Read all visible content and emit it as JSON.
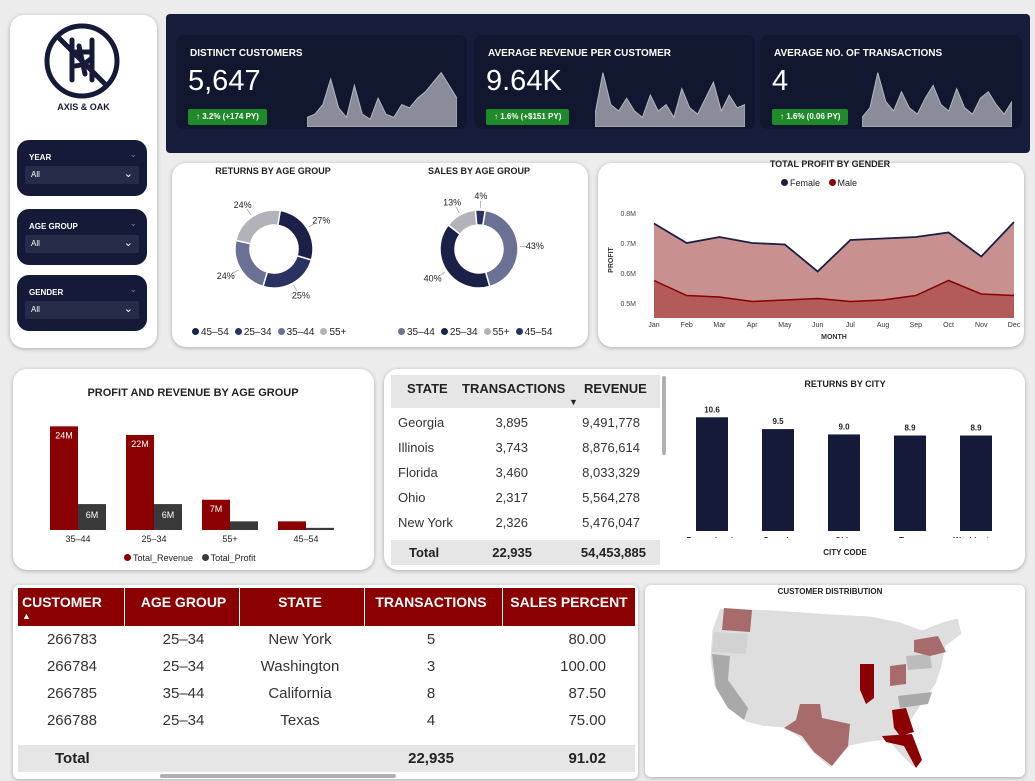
{
  "brand": {
    "name": "AXIS & OAK"
  },
  "filters": [
    {
      "label": "YEAR",
      "value": "All"
    },
    {
      "label": "AGE GROUP",
      "value": "All"
    },
    {
      "label": "GENDER",
      "value": "All"
    }
  ],
  "kpis": [
    {
      "title": "DISTINCT CUSTOMERS",
      "value": "5,647",
      "badge": "↑ 3.2% (+174 PY)"
    },
    {
      "title": "AVERAGE REVENUE PER CUSTOMER",
      "value": "9.64K",
      "badge": "↑ 1.6% (+$151 PY)"
    },
    {
      "title": "AVERAGE NO. OF TRANSACTIONS",
      "value": "4",
      "badge": "↑ 1.6% (0.06 PY)"
    }
  ],
  "returns_age": {
    "title": "RETURNS BY AGE GROUP",
    "labels": [
      "27%",
      "25%",
      "24%",
      "24%"
    ],
    "legend": [
      "45–54",
      "25–34",
      "35–44",
      "55+"
    ]
  },
  "sales_age": {
    "title": "SALES BY AGE GROUP",
    "labels": [
      "43%",
      "40%",
      "13%",
      "4%"
    ],
    "legend": [
      "35–44",
      "25–34",
      "55+",
      "45–54"
    ]
  },
  "profit_gender": {
    "title": "TOTAL PROFIT BY GENDER",
    "legend": [
      "Female",
      "Male"
    ],
    "ylabel": "PROFIT",
    "xlabel": "MONTH",
    "yticks": [
      "0.8M",
      "0.7M",
      "0.6M",
      "0.5M"
    ],
    "months": [
      "Jan",
      "Feb",
      "Mar",
      "Apr",
      "May",
      "Jun",
      "Jul",
      "Aug",
      "Sep",
      "Oct",
      "Nov",
      "Dec"
    ]
  },
  "profit_revenue": {
    "title": "PROFIT AND REVENUE BY AGE GROUP",
    "categories": [
      "35–44",
      "25–34",
      "55+",
      "45–54"
    ],
    "rev_labels": [
      "24M",
      "22M",
      "7M",
      ""
    ],
    "prof_labels": [
      "6M",
      "6M",
      "",
      ""
    ],
    "legend": [
      "Total_Revenue",
      "Total_Profit"
    ]
  },
  "state_table": {
    "headers": [
      "STATE",
      "TRANSACTIONS",
      "REVENUE"
    ],
    "rows": [
      [
        "Georgia",
        "3,895",
        "9,491,778"
      ],
      [
        "Illinois",
        "3,743",
        "8,876,614"
      ],
      [
        "Florida",
        "3,460",
        "8,033,329"
      ],
      [
        "Ohio",
        "2,317",
        "5,564,278"
      ],
      [
        "New York",
        "2,326",
        "5,476,047"
      ]
    ],
    "total": [
      "Total",
      "22,935",
      "54,453,885"
    ]
  },
  "returns_city": {
    "title": "RETURNS BY CITY",
    "xlabel": "CITY CODE",
    "cities": [
      "Pennsylvania",
      "Georgia",
      "Ohio",
      "Texas",
      "Washington"
    ],
    "labels": [
      "10.6",
      "9.5",
      "9.0",
      "8.9",
      "8.9"
    ]
  },
  "customer_table": {
    "headers": [
      "CUSTOMER",
      "AGE GROUP",
      "STATE",
      "TRANSACTIONS",
      "SALES PERCENT"
    ],
    "rows": [
      [
        "266783",
        "25–34",
        "New York",
        "5",
        "80.00"
      ],
      [
        "266784",
        "25–34",
        "Washington",
        "3",
        "100.00"
      ],
      [
        "266785",
        "35–44",
        "California",
        "8",
        "87.50"
      ],
      [
        "266788",
        "25–34",
        "Texas",
        "4",
        "75.00"
      ]
    ],
    "total": [
      "Total",
      "",
      "",
      "22,935",
      "91.02"
    ]
  },
  "map": {
    "title": "CUSTOMER DISTRIBUTION"
  },
  "chart_data": [
    {
      "type": "pie",
      "title": "RETURNS BY AGE GROUP",
      "categories": [
        "45–54",
        "25–34",
        "35–44",
        "55+"
      ],
      "values": [
        27,
        25,
        24,
        24
      ],
      "colors": [
        "#1b2048",
        "#2a3163",
        "#6b7194",
        "#b1b2ba"
      ]
    },
    {
      "type": "pie",
      "title": "SALES BY AGE GROUP",
      "categories": [
        "35–44",
        "25–34",
        "55+",
        "45–54"
      ],
      "values": [
        43,
        40,
        13,
        4
      ],
      "colors": [
        "#6b7194",
        "#1b2048",
        "#b1b2ba",
        "#2a3163"
      ]
    },
    {
      "type": "area",
      "title": "TOTAL PROFIT BY GENDER",
      "ylim": [
        0.45,
        0.85
      ],
      "categories": [
        "Jan",
        "Feb",
        "Mar",
        "Apr",
        "May",
        "Jun",
        "Jul",
        "Aug",
        "Sep",
        "Oct",
        "Nov",
        "Dec"
      ],
      "series": [
        {
          "name": "Female",
          "color": "#1b2048",
          "values": [
            0.765,
            0.7,
            0.72,
            0.7,
            0.695,
            0.605,
            0.71,
            0.715,
            0.72,
            0.735,
            0.655,
            0.77
          ]
        },
        {
          "name": "Male",
          "color": "#8b0000",
          "values": [
            0.575,
            0.525,
            0.52,
            0.505,
            0.51,
            0.515,
            0.505,
            0.51,
            0.525,
            0.575,
            0.53,
            0.525
          ]
        }
      ]
    },
    {
      "type": "bar",
      "title": "PROFIT AND REVENUE BY AGE GROUP",
      "categories": [
        "35–44",
        "25–34",
        "55+",
        "45–54"
      ],
      "series": [
        {
          "name": "Total_Revenue",
          "color": "#8b0000",
          "values": [
            24,
            22,
            7,
            2
          ]
        },
        {
          "name": "Total_Profit",
          "color": "#3a3a3a",
          "values": [
            6,
            6,
            2,
            0.5
          ]
        }
      ],
      "ylim": [
        0,
        25
      ]
    },
    {
      "type": "bar",
      "title": "RETURNS BY CITY",
      "xlabel": "CITY CODE",
      "categories": [
        "Pennsylvania",
        "Georgia",
        "Ohio",
        "Texas",
        "Washington"
      ],
      "values": [
        10.6,
        9.5,
        9.0,
        8.9,
        8.9
      ],
      "ylim": [
        0,
        11
      ]
    }
  ],
  "sparklines": [
    [
      0.15,
      0.2,
      0.35,
      0.75,
      0.3,
      0.15,
      0.65,
      0.2,
      0.12,
      0.45,
      0.2,
      0.15,
      0.35,
      0.3,
      0.45,
      0.55,
      0.7,
      0.85,
      0.65,
      0.45
    ],
    [
      0.2,
      0.85,
      0.35,
      0.25,
      0.45,
      0.25,
      0.15,
      0.5,
      0.25,
      0.35,
      0.15,
      0.6,
      0.3,
      0.2,
      0.45,
      0.7,
      0.25,
      0.5,
      0.3,
      0.35
    ],
    [
      0.15,
      0.3,
      0.85,
      0.4,
      0.25,
      0.55,
      0.3,
      0.2,
      0.45,
      0.65,
      0.35,
      0.25,
      0.6,
      0.3,
      0.2,
      0.45,
      0.55,
      0.35,
      0.2,
      0.4
    ]
  ]
}
